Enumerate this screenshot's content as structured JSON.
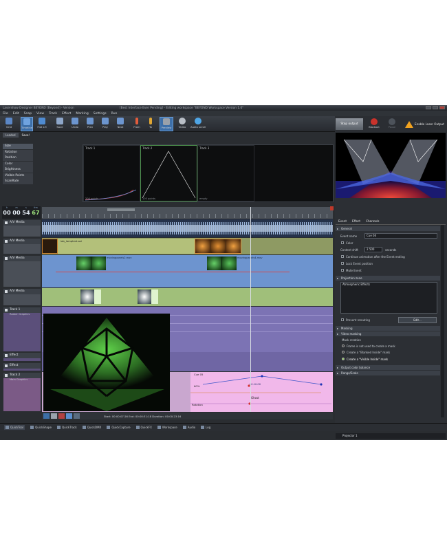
{
  "window": {
    "title_left": "Lasershow Designer BEYOND [Beyond] - Version",
    "title_center": "[Best Interface Ever Pending] - Editing workspace \"BEYOND Workspace Version 1.0\""
  },
  "menu": [
    "File",
    "Edit",
    "Snap",
    "View",
    "Track",
    "Effect",
    "Marking",
    "Settings",
    "Run"
  ],
  "toolbar": {
    "tools": [
      {
        "label": "Grid",
        "icon": "grid-icon",
        "color": "#5b87c6",
        "active": false
      },
      {
        "label": "Timeline",
        "icon": "timeline-icon",
        "color": "#6fa3df",
        "active": true
      },
      {
        "label": "Flat LH",
        "icon": "layers-icon",
        "color": "#4f8bd1",
        "active": false
      },
      {
        "label": "Save",
        "icon": "save-icon",
        "color": "#8da6c9",
        "active": false
      },
      {
        "label": "Undo",
        "icon": "undo-icon",
        "color": "#6c95cf",
        "active": false
      },
      {
        "label": "Prev",
        "icon": "prev-icon",
        "color": "#6c95cf",
        "active": false
      },
      {
        "label": "Play",
        "icon": "play-icon",
        "color": "#6c95cf",
        "active": false
      },
      {
        "label": "Next",
        "icon": "next-icon",
        "color": "#6c95cf",
        "active": false
      },
      {
        "label": "From",
        "icon": "marker-from-icon",
        "color": "#e25c3c",
        "active": false
      },
      {
        "label": "To",
        "icon": "marker-to-icon",
        "color": "#e0a733",
        "active": false
      },
      {
        "label": "Preview",
        "icon": "preview-icon",
        "color": "#9aa1aa",
        "active": true
      },
      {
        "label": "Video",
        "icon": "video-icon",
        "color": "#b8bec6",
        "active": false
      },
      {
        "label": "Audio scroll",
        "icon": "audio-scroll-icon",
        "color": "#4fa6e6",
        "active": false
      }
    ],
    "stop_output": "Stop output",
    "blackout": "Blackout",
    "pause": "Pause",
    "enable_laser": "Enable Laser Output"
  },
  "left_tabs": [
    "Loaded",
    "Save!"
  ],
  "properties": [
    "Size",
    "Rotation",
    "Position",
    "Color",
    "Brightness",
    "Visible Points",
    "ScanRate"
  ],
  "graphs": [
    {
      "label": "Track 1",
      "foot": "200 points"
    },
    {
      "label": "Track 2",
      "foot": "100 points"
    },
    {
      "label": "Track 3",
      "foot": "empty"
    }
  ],
  "counter": [
    {
      "caption": "h",
      "value": "00"
    },
    {
      "caption": "m",
      "value": "00"
    },
    {
      "caption": "s",
      "value": "54"
    },
    {
      "caption": "frm",
      "value": "67"
    }
  ],
  "tracks": [
    {
      "title": "A/V Media",
      "sub": ""
    },
    {
      "title": "A/V Media",
      "sub": ""
    },
    {
      "title": "A/V Media",
      "sub": ""
    },
    {
      "title": "A/V Media",
      "sub": ""
    },
    {
      "title": "Track 1",
      "sub": "Raster Graphics"
    },
    {
      "title": "Effect",
      "sub": ""
    },
    {
      "title": "Effect",
      "sub": ""
    },
    {
      "title": "Track 2",
      "sub": "Main Graphics"
    }
  ],
  "clips": {
    "media1": "lab_lamptest.avi",
    "media2a": "movingpanels2.mov",
    "media2b": "movingpanels4.mov",
    "cue": "Cue 05",
    "value1": "60%",
    "value2": "60.10.00",
    "ghost": "Ghost",
    "rotation": "Rotation"
  },
  "timeline_footer": {
    "info": "Start: 00:00:07:26   End: 00:00:31:18   Duration: 00:00:23:16"
  },
  "bottom_tabs": [
    "QuickTool",
    "QuickShape",
    "QuickTrack",
    "QuickDMX",
    "QuickCapture",
    "QuickFX",
    "Workspace",
    "Audio",
    "Log"
  ],
  "right_panel": {
    "tabs": [
      "Event",
      "Effect",
      "Channels"
    ],
    "general": "General",
    "event_name_label": "Event name",
    "event_name": "Cue 04",
    "color_label": "Color",
    "content_shift_label": "Content shift",
    "content_shift_value": "2.500",
    "seconds": "seconds",
    "continue_anim": "Continue animation after the Event ending",
    "lock_pos": "Lock Event position",
    "mute": "Mute Event",
    "projection_zone": "Projection zone",
    "zone_item": "Atmospheric Effects",
    "prevent": "Prevent rerouting",
    "edit": "Edit...",
    "masking": "Masking",
    "video_masking": "Video masking",
    "mask_creation": "Mask creation",
    "mask_opt1": "Frame is not used to create a mask",
    "mask_opt2": "Create a \"Blanked Inside\" mask",
    "mask_opt3": "Create a \"Visible Inside\" mask",
    "output_balance": "Output color balance",
    "range_scale": "Range/Scale",
    "projector": "Projector 1"
  }
}
